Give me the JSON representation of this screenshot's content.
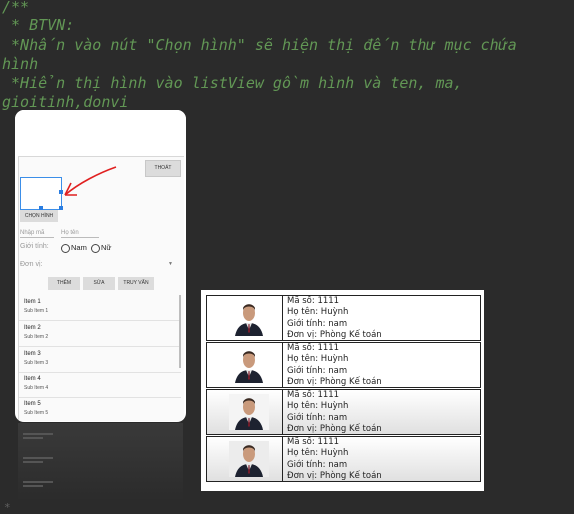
{
  "editor": {
    "code_lines": [
      "/**",
      " * BTVN:",
      " *Nhấn vào nút \"Chọn hình\" sẽ hiện thị đến thư mục chứa",
      "hình",
      " *Hiển thị hình vào listView gồm hình và ten, ma,",
      "gioitinh,donvi"
    ],
    "gutter_mark": "*",
    "colors": {
      "background": "#2b2b2b",
      "comment": "#629755"
    }
  },
  "phone": {
    "exit_button": "THOÁT",
    "pick_image_button": "CHỌN HÌNH",
    "id_placeholder": "Nhập mã",
    "name_placeholder": "Họ tên",
    "gender_label": "Giới tính:",
    "gender_options": [
      "Nam",
      "Nữ"
    ],
    "unit_label": "Đơn vị:",
    "dropdown_icon": "triangle-down-icon",
    "actions": [
      "THÊM",
      "SỬA",
      "TRUY VẤN"
    ],
    "list_items": [
      {
        "title": "Item 1",
        "subtitle": "Sub Item 1"
      },
      {
        "title": "Item 2",
        "subtitle": "Sub Item 2"
      },
      {
        "title": "Item 3",
        "subtitle": "Sub Item 3"
      },
      {
        "title": "Item 4",
        "subtitle": "Sub Item 4"
      },
      {
        "title": "Item 5",
        "subtitle": "Sub Item 5"
      }
    ],
    "colors": {
      "selection": "#3b8ee8",
      "annotation_arrow": "#e02020"
    }
  },
  "preview": {
    "rows": [
      {
        "id": "Mã số: 1111",
        "name": "Họ tên: Huỳnh",
        "gender": "Giới tính: nam",
        "unit": "Đơn vị: Phòng Kế toán"
      },
      {
        "id": "Mã số: 1111",
        "name": "Họ tên: Huỳnh",
        "gender": "Giới tính: nam",
        "unit": "Đơn vị: Phòng Kế toán"
      },
      {
        "id": "Mã số: 1111",
        "name": "Họ tên: Huỳnh",
        "gender": "Giới tính: nam",
        "unit": "Đơn vị: Phòng Kế toán"
      },
      {
        "id": "Mã số: 1111",
        "name": "Họ tên: Huỳnh",
        "gender": "Giới tính: nam",
        "unit": "Đơn vị: Phòng Kế toán"
      }
    ]
  }
}
